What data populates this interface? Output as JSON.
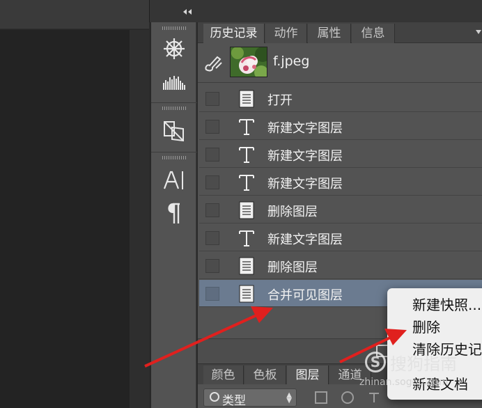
{
  "history_panel": {
    "tabs": [
      "历史记录",
      "动作",
      "属性",
      "信息"
    ],
    "active_tab": "历史记录",
    "snapshot": {
      "name": "f.jpeg"
    },
    "items": [
      {
        "label": "打开",
        "icon": "document-icon",
        "selected": false
      },
      {
        "label": "新建文字图层",
        "icon": "type-icon",
        "selected": false
      },
      {
        "label": "新建文字图层",
        "icon": "type-icon",
        "selected": false
      },
      {
        "label": "新建文字图层",
        "icon": "type-icon",
        "selected": false
      },
      {
        "label": "删除图层",
        "icon": "document-icon",
        "selected": false
      },
      {
        "label": "新建文字图层",
        "icon": "type-icon",
        "selected": false
      },
      {
        "label": "删除图层",
        "icon": "document-icon",
        "selected": false
      },
      {
        "label": "合并可见图层",
        "icon": "document-icon",
        "selected": true
      }
    ]
  },
  "layers_panel": {
    "tabs": [
      "颜色",
      "色板",
      "图层",
      "通道"
    ],
    "active_tab": "图层",
    "filter_label": "类型"
  },
  "context_menu": {
    "items": [
      "新建快照...",
      "删除",
      "清除历史记",
      "新建文档"
    ]
  },
  "watermark": {
    "title": "搜狗指南",
    "url": "zhinan.sogou.com",
    "logo_letter": "S"
  },
  "colors": {
    "panel_bg": "#535353",
    "selected_row": "#6b7b90",
    "annotation_arrow": "#e0201e",
    "menu_bg": "#efefef"
  }
}
